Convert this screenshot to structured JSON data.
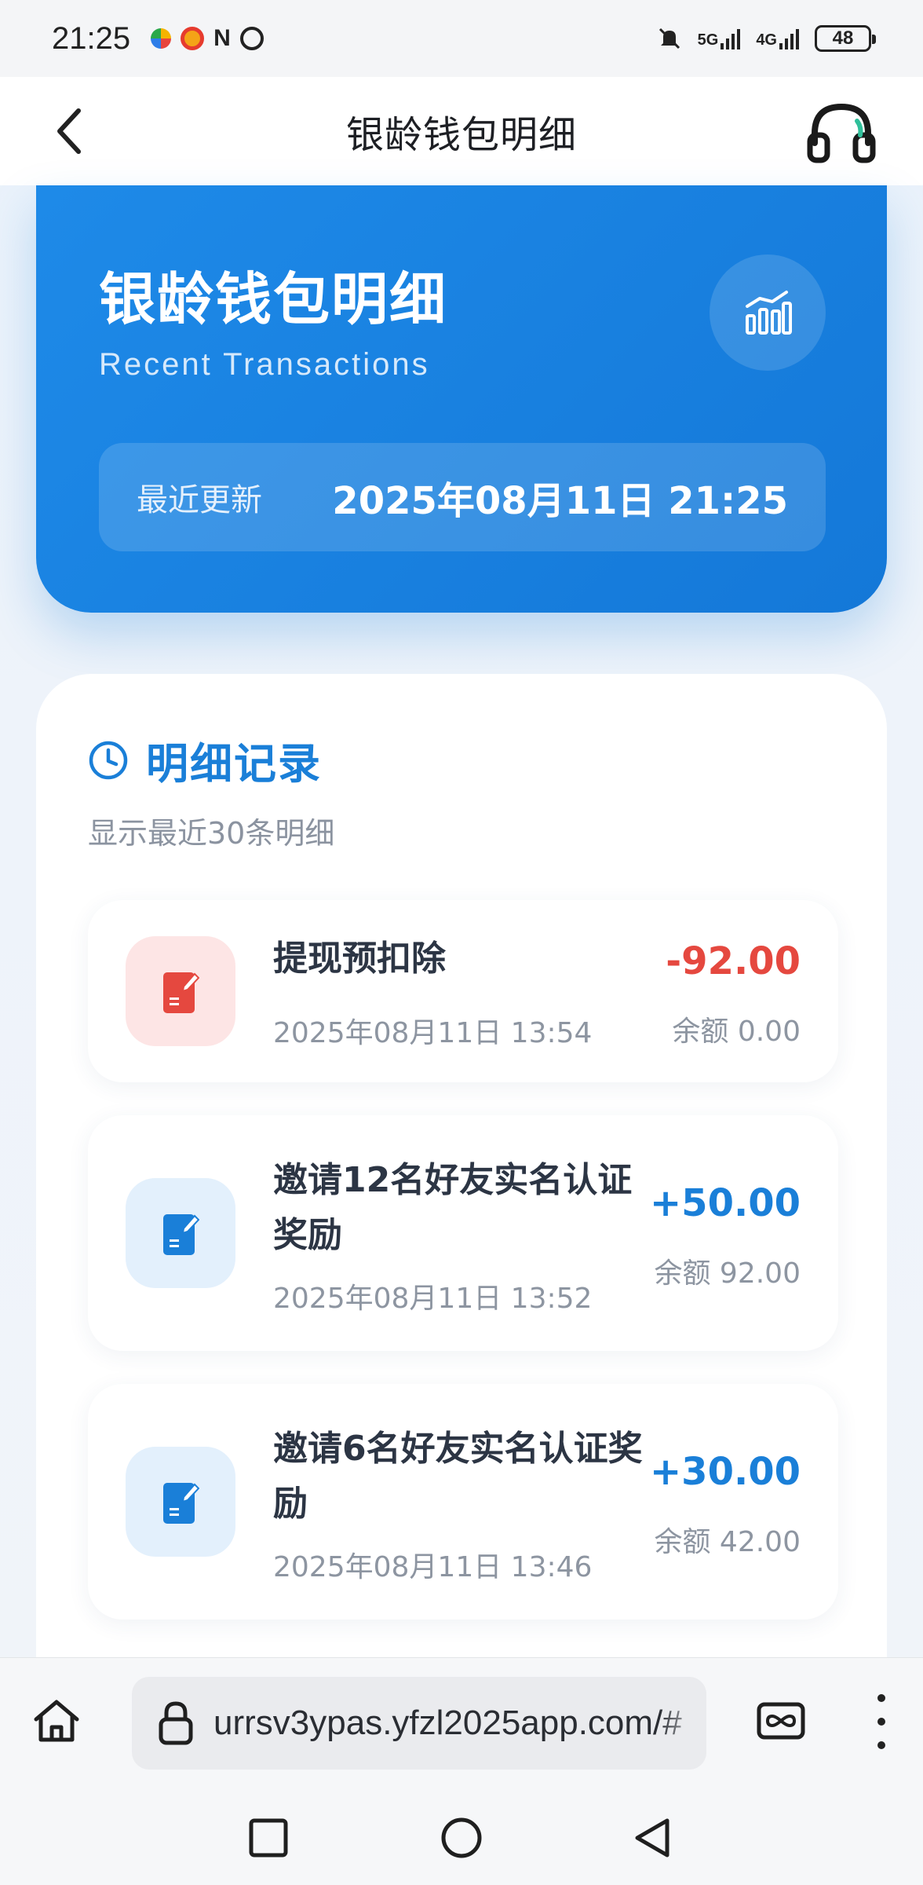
{
  "status_bar": {
    "time": "21:25",
    "network_1": "5G",
    "network_2": "4G",
    "battery": "48"
  },
  "nav": {
    "title": "银龄钱包明细"
  },
  "hero": {
    "title": "银龄钱包明细",
    "subtitle": "Recent Transactions",
    "update_label": "最近更新",
    "update_value": "2025年08月11日 21:25"
  },
  "records": {
    "title": "明细记录",
    "subtitle": "显示最近30条明细",
    "items": [
      {
        "title": "提现预扣除",
        "time": "2025年08月11日 13:54",
        "amount": "-92.00",
        "balance": "余额 0.00",
        "type": "debit"
      },
      {
        "title": "邀请12名好友实名认证奖励",
        "time": "2025年08月11日 13:52",
        "amount": "+50.00",
        "balance": "余额 92.00",
        "type": "credit"
      },
      {
        "title": "邀请6名好友实名认证奖励",
        "time": "2025年08月11日 13:46",
        "amount": "+30.00",
        "balance": "余额 42.00",
        "type": "credit"
      }
    ]
  },
  "browser": {
    "url": "urrsv3ypas.yfzl2025app.com/#"
  },
  "colors": {
    "accent": "#1a7fd8",
    "hero_blue": "#1e8ae8",
    "debit_red": "#e5483f"
  },
  "icons": {
    "back": "chevron-left-icon",
    "support": "headset-icon",
    "chart": "bar-chart-icon",
    "clock": "clock-icon",
    "record": "note-edit-icon",
    "home": "home-icon",
    "lock": "lock-icon",
    "tabs": "tabs-icon",
    "more": "more-vertical-icon"
  }
}
